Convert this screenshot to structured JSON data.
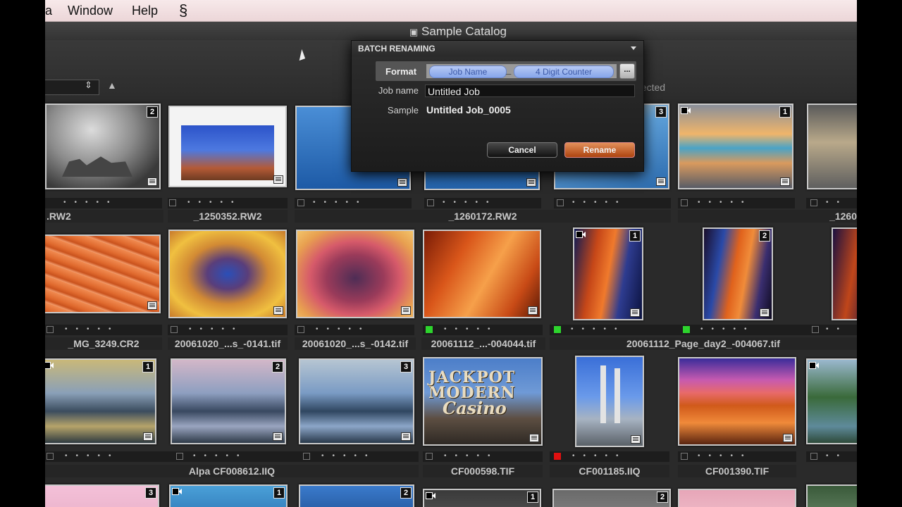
{
  "menubar": {
    "items": [
      "a",
      "Window",
      "Help"
    ],
    "script_icon": "script-menu-icon"
  },
  "window": {
    "title": "Sample Catalog",
    "selection_status": "mages selected"
  },
  "grid": {
    "rows": [
      {
        "tiles": [
          {
            "label": "stack-tile",
            "badge": "2"
          },
          {
            "label": "stack-tile",
            "badge": ""
          },
          {
            "label": "stack-tile",
            "badge": ""
          },
          {
            "label": "stack-tile",
            "badge": ""
          },
          {
            "label": "stack-tile",
            "badge": "3"
          },
          {
            "label": "stack-tile",
            "badge": "1"
          },
          {
            "label": "stack-tile",
            "badge": ""
          }
        ],
        "filenames": [
          ".RW2",
          "_1250352.RW2",
          "_1260172.RW2",
          "_1260"
        ]
      },
      {
        "tiles": [
          {
            "badge": ""
          },
          {
            "badge": ""
          },
          {
            "badge": ""
          },
          {
            "badge": ""
          },
          {
            "badge": "1"
          },
          {
            "badge": "2"
          },
          {
            "badge": ""
          }
        ],
        "filenames": [
          "_MG_3249.CR2",
          "20061020_...s_-0141.tif",
          "20061020_...s_-0142.tif",
          "20061112_...-004044.tif",
          "20061112_Page_day2_-004067.tif"
        ]
      },
      {
        "tiles": [
          {
            "badge": "1"
          },
          {
            "badge": "2"
          },
          {
            "badge": "3"
          },
          {
            "badge": ""
          },
          {
            "badge": ""
          },
          {
            "badge": ""
          },
          {
            "badge": ""
          }
        ],
        "filenames": [
          "Alpa CF008612.IIQ",
          "CF000598.TIF",
          "CF001185.IIQ",
          "CF001390.TIF"
        ]
      },
      {
        "tiles": [
          {
            "badge": "3"
          },
          {
            "badge": "1"
          },
          {
            "badge": "2"
          },
          {
            "badge": "1"
          },
          {
            "badge": "2"
          },
          {
            "badge": ""
          },
          {
            "badge": ""
          }
        ]
      }
    ],
    "casino_sign": {
      "line1": "JACKPOT",
      "line2": "MODERN",
      "line3": "Casino"
    }
  },
  "dialog": {
    "title": "BATCH RENAMING",
    "format_label": "Format",
    "token_job_name": "Job Name",
    "token_separator": "_",
    "token_counter": "4 Digit Counter",
    "more_button": "...",
    "job_name_label": "Job name",
    "job_name_value": "Untitled Job",
    "sample_label": "Sample",
    "sample_value": "Untitled Job_0005",
    "cancel_label": "Cancel",
    "rename_label": "Rename"
  },
  "colors": {
    "rename_button": "#c8602a",
    "token": "#a9bff2",
    "color_label_green": "#2dd42d",
    "color_label_red": "#e01010"
  }
}
